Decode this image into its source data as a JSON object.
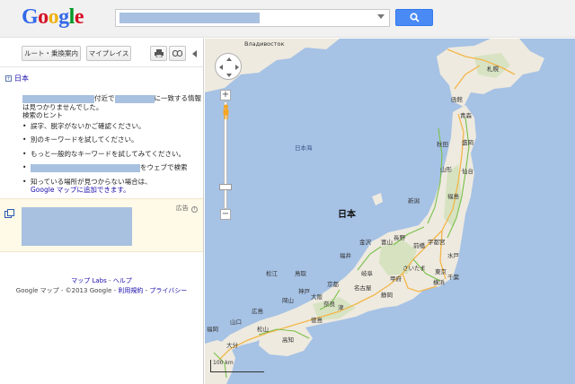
{
  "header": {
    "logo_letters": [
      {
        "ch": "G",
        "color": "#3369e8"
      },
      {
        "ch": "o",
        "color": "#d50f25"
      },
      {
        "ch": "o",
        "color": "#eeb211"
      },
      {
        "ch": "g",
        "color": "#3369e8"
      },
      {
        "ch": "l",
        "color": "#009925"
      },
      {
        "ch": "e",
        "color": "#d50f25"
      }
    ],
    "search_button_icon": "search-icon"
  },
  "toolbar": {
    "route_label": "ルート・乗換案内",
    "myplaces_label": "マイプレイス",
    "print_icon": "print-icon",
    "link_icon": "link-icon"
  },
  "breadcrumb": {
    "label": "日本"
  },
  "results": {
    "not_found_middle": "付近で",
    "not_found_end": "に一致する情報",
    "not_found_line2": "は見つかりませんでした。",
    "hints_title": "検索のヒント",
    "hints": [
      "誤字、脱字がないかご確認ください。",
      "別のキーワードを試してください。",
      "もっと一般的なキーワードを試してみてください。"
    ],
    "web_search_suffix": "をウェブで検索",
    "unknown_place_text": "知っている場所が見つからない場合は、",
    "add_to_maps_link": "Google マップに追加できます。"
  },
  "ad": {
    "label": "広告",
    "info_icon": "info-icon"
  },
  "footer": {
    "labs_link": "マップ Labs",
    "help_link": "ヘルプ",
    "copyright": "Google マップ - ©2013 Google -",
    "terms_link": "利用規約",
    "privacy_link": "プライバシー"
  },
  "map": {
    "country_label": "日本",
    "sea_label": "日本海",
    "scale_text": "100 km",
    "cities": [
      {
        "name": "Владивосток"
      },
      {
        "name": "札幌"
      },
      {
        "name": "函館"
      },
      {
        "name": "青森"
      },
      {
        "name": "秋田"
      },
      {
        "name": "盛岡"
      },
      {
        "name": "山形"
      },
      {
        "name": "仙台"
      },
      {
        "name": "新潟"
      },
      {
        "name": "福島"
      },
      {
        "name": "金沢"
      },
      {
        "name": "富山"
      },
      {
        "name": "長野"
      },
      {
        "name": "前橋"
      },
      {
        "name": "宇都宮"
      },
      {
        "name": "さいたま"
      },
      {
        "name": "東京"
      },
      {
        "name": "横浜"
      },
      {
        "name": "水戸"
      },
      {
        "name": "千葉"
      },
      {
        "name": "福井"
      },
      {
        "name": "岐阜"
      },
      {
        "name": "名古屋"
      },
      {
        "name": "静岡"
      },
      {
        "name": "甲府"
      },
      {
        "name": "京都"
      },
      {
        "name": "大阪"
      },
      {
        "name": "神戸"
      },
      {
        "name": "奈良"
      },
      {
        "name": "津"
      },
      {
        "name": "鳥取"
      },
      {
        "name": "松江"
      },
      {
        "name": "岡山"
      },
      {
        "name": "広島"
      },
      {
        "name": "山口"
      },
      {
        "name": "徳島"
      },
      {
        "name": "高知"
      },
      {
        "name": "松山"
      },
      {
        "name": "福岡"
      },
      {
        "name": "大分"
      }
    ]
  }
}
